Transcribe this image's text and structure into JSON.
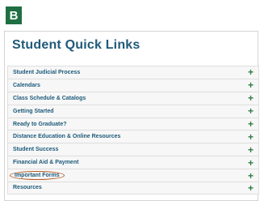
{
  "badge": {
    "letter": "B"
  },
  "page": {
    "title": "Student Quick Links"
  },
  "links": [
    {
      "label": "Student Judicial Process",
      "icon": "plus-icon"
    },
    {
      "label": "Calendars",
      "icon": "plus-icon"
    },
    {
      "label": "Class Schedule & Catalogs",
      "icon": "plus-icon"
    },
    {
      "label": "Getting Started",
      "icon": "plus-icon"
    },
    {
      "label": "Ready to Graduate?",
      "icon": "plus-icon"
    },
    {
      "label": "Distance Education & Online Resources",
      "icon": "plus-icon"
    },
    {
      "label": "Student Success",
      "icon": "plus-icon"
    },
    {
      "label": "Financial Aid & Payment",
      "icon": "plus-icon"
    },
    {
      "label": "Important Forms",
      "icon": "plus-icon",
      "highlighted": true
    },
    {
      "label": "Resources",
      "icon": "plus-icon"
    }
  ],
  "colors": {
    "badge": "#1f6f43",
    "title": "#1f5a7a",
    "link": "#1c5a7a",
    "plus": "#2f7d45",
    "highlight_circle": "#b85a24"
  }
}
